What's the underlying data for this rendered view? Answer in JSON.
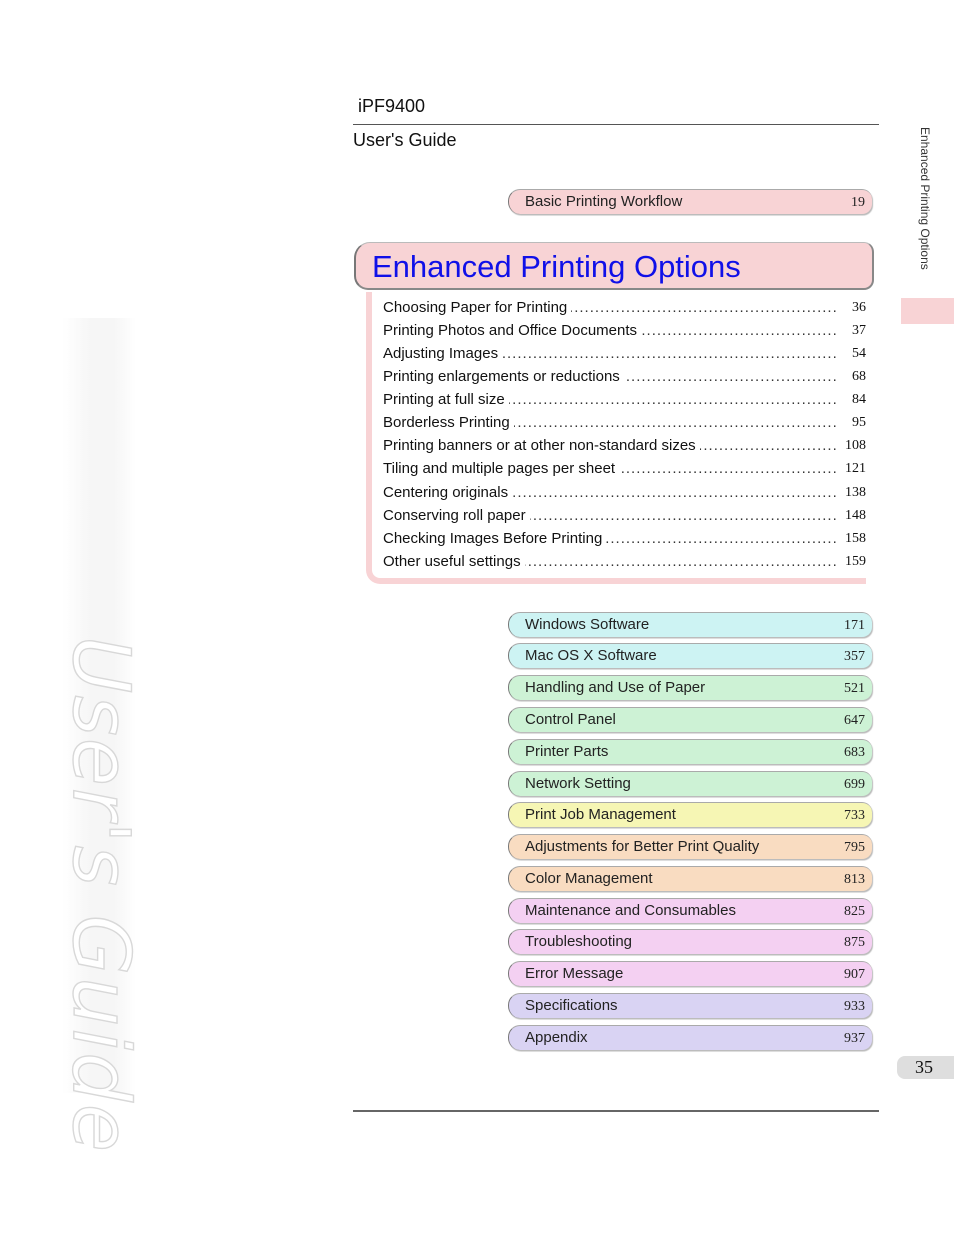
{
  "header": {
    "model": "iPF9400",
    "guide": "User's Guide"
  },
  "watermark": "User's Guide",
  "side_label": "Enhanced Printing Options",
  "page_number": "35",
  "colors": {
    "pink": "#f8d3d5",
    "cyan": "#cdf3f3",
    "green": "#cdf2d5",
    "yellow": "#f6f6b4",
    "orange": "#f9dcc1",
    "magenta": "#f4d0f2",
    "lavender": "#d9d3f3",
    "title_blue": "#1010e8"
  },
  "prev_chapter": {
    "title": "Basic Printing Workflow",
    "page": "19",
    "color": "#f8d3d5"
  },
  "section": {
    "title": "Enhanced Printing Options",
    "entries": [
      {
        "title": "Choosing Paper for Printing",
        "page": "36"
      },
      {
        "title": "Printing Photos and Office Documents",
        "page": "37"
      },
      {
        "title": "Adjusting Images",
        "page": "54"
      },
      {
        "title": "Printing enlargements or reductions",
        "page": "68"
      },
      {
        "title": "Printing at full size",
        "page": "84"
      },
      {
        "title": "Borderless Printing",
        "page": "95"
      },
      {
        "title": "Printing banners or at other non-standard sizes",
        "page": "108"
      },
      {
        "title": "Tiling and multiple pages per sheet",
        "page": "121"
      },
      {
        "title": "Centering originals",
        "page": "138"
      },
      {
        "title": "Conserving roll paper",
        "page": "148"
      },
      {
        "title": "Checking Images Before Printing",
        "page": "158"
      },
      {
        "title": "Other useful settings",
        "page": "159"
      }
    ]
  },
  "chapters": [
    {
      "title": "Windows Software",
      "page": "171",
      "color": "#cdf3f3"
    },
    {
      "title": "Mac OS X Software",
      "page": "357",
      "color": "#cdf3f3"
    },
    {
      "title": "Handling and Use of Paper",
      "page": "521",
      "color": "#cdf2d5"
    },
    {
      "title": "Control Panel",
      "page": "647",
      "color": "#cdf2d5"
    },
    {
      "title": "Printer Parts",
      "page": "683",
      "color": "#cdf2d5"
    },
    {
      "title": "Network Setting",
      "page": "699",
      "color": "#cdf2d5"
    },
    {
      "title": "Print Job Management",
      "page": "733",
      "color": "#f6f6b4"
    },
    {
      "title": "Adjustments for Better Print Quality",
      "page": "795",
      "color": "#f9dcc1"
    },
    {
      "title": "Color Management",
      "page": "813",
      "color": "#f9dcc1"
    },
    {
      "title": "Maintenance and Consumables",
      "page": "825",
      "color": "#f4d0f2"
    },
    {
      "title": "Troubleshooting",
      "page": "875",
      "color": "#f4d0f2"
    },
    {
      "title": "Error Message",
      "page": "907",
      "color": "#f4d0f2"
    },
    {
      "title": "Specifications",
      "page": "933",
      "color": "#d9d3f3"
    },
    {
      "title": "Appendix",
      "page": "937",
      "color": "#d9d3f3"
    }
  ]
}
